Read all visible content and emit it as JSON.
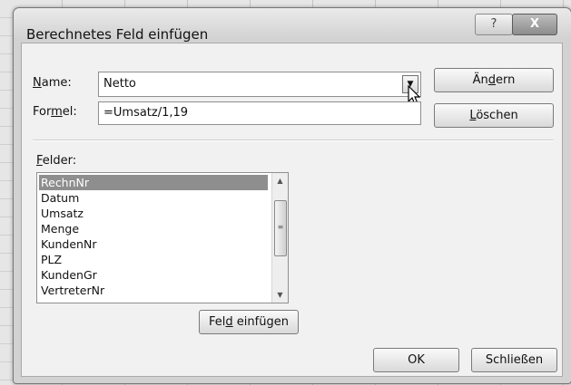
{
  "dialog": {
    "title": "Berechnetes Feld einfügen",
    "help_label": "?",
    "close_label": "X"
  },
  "form": {
    "name_label_key": "N",
    "name_label_rest": "ame:",
    "name_value": "Netto",
    "formula_label_pre": "For",
    "formula_label_key": "m",
    "formula_label_rest": "el:",
    "formula_value": "=Umsatz/1,19"
  },
  "buttons": {
    "change_pre": "Än",
    "change_key": "d",
    "change_rest": "ern",
    "delete_key": "L",
    "delete_rest": "öschen",
    "insert_pre": "Fel",
    "insert_key": "d",
    "insert_rest": " einfügen",
    "ok": "OK",
    "close": "Schließen"
  },
  "fields": {
    "label_key": "F",
    "label_rest": "elder:",
    "items": [
      "RechnNr",
      "Datum",
      "Umsatz",
      "Menge",
      "KundenNr",
      "PLZ",
      "KundenGr",
      "VertreterNr"
    ],
    "selected": "RechnNr"
  },
  "icons": {
    "dropdown": "chevron-down-icon",
    "cursor": "mouse-pointer-icon",
    "help": "help-icon",
    "close": "close-icon"
  }
}
